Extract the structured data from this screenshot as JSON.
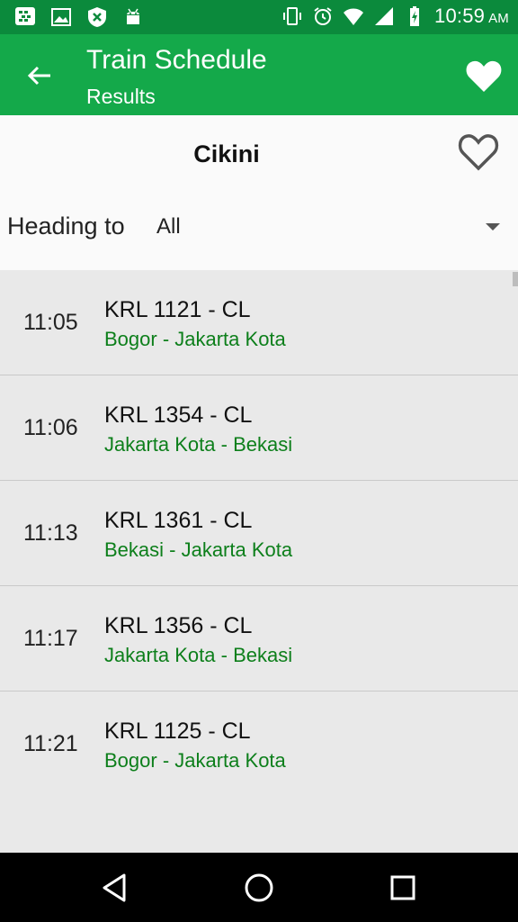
{
  "status_bar": {
    "time": "10:59",
    "ampm": "AM",
    "left_icons": [
      "bbm-icon",
      "image-icon",
      "shield-x-icon",
      "android-icon"
    ],
    "right_icons": [
      "vibrate-icon",
      "alarm-icon",
      "wifi-icon",
      "signal-icon",
      "battery-charging-icon"
    ]
  },
  "app_bar": {
    "title": "Train Schedule",
    "subtitle": "Results"
  },
  "header": {
    "station": "Cikini",
    "heading_label": "Heading to",
    "heading_value": "All"
  },
  "schedule": [
    {
      "time": "11:05",
      "train": "KRL 1121 - CL",
      "route": "Bogor - Jakarta Kota"
    },
    {
      "time": "11:06",
      "train": "KRL 1354 - CL",
      "route": "Jakarta Kota - Bekasi"
    },
    {
      "time": "11:13",
      "train": "KRL 1361 - CL",
      "route": "Bekasi - Jakarta Kota"
    },
    {
      "time": "11:17",
      "train": "KRL 1356 - CL",
      "route": "Jakarta Kota - Bekasi"
    },
    {
      "time": "11:21",
      "train": "KRL 1125 - CL",
      "route": "Bogor - Jakarta Kota"
    }
  ],
  "colors": {
    "app_bar": "#14a94a",
    "status_bar": "#0b8a3c",
    "route_text": "#0d7f1b"
  }
}
